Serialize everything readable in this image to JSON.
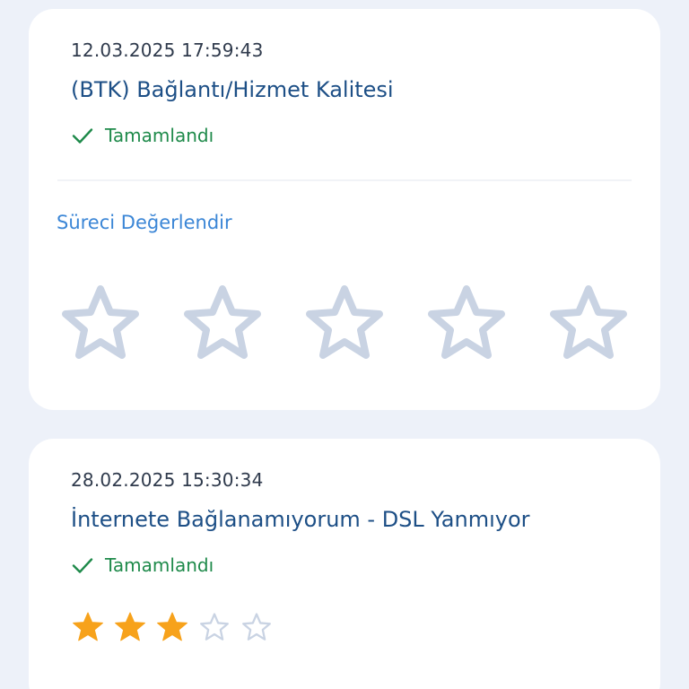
{
  "requests": [
    {
      "date": "12.03.2025 17:59:43",
      "title": "(BTK) Bağlantı/Hizmet Kalitesi",
      "status": "Tamamlandı",
      "rate_prompt": "Süreci Değerlendir",
      "rating_stars_total": 5,
      "rating_value": 0
    },
    {
      "date": "28.02.2025 15:30:34",
      "title": "İnternete Bağlanamıyorum - DSL Yanmıyor",
      "status": "Tamamlandı",
      "rating_stars_total": 5,
      "rating_value": 3
    }
  ],
  "colors": {
    "background": "#edf1f9",
    "card": "#ffffff",
    "title": "#1d4f86",
    "status": "#1e8a4a",
    "link": "#3b86d6",
    "star_filled": "#f7a21b",
    "star_empty_outline": "#c9d3e3"
  },
  "icons": {
    "status": "check-icon",
    "rating": "star-icon"
  }
}
